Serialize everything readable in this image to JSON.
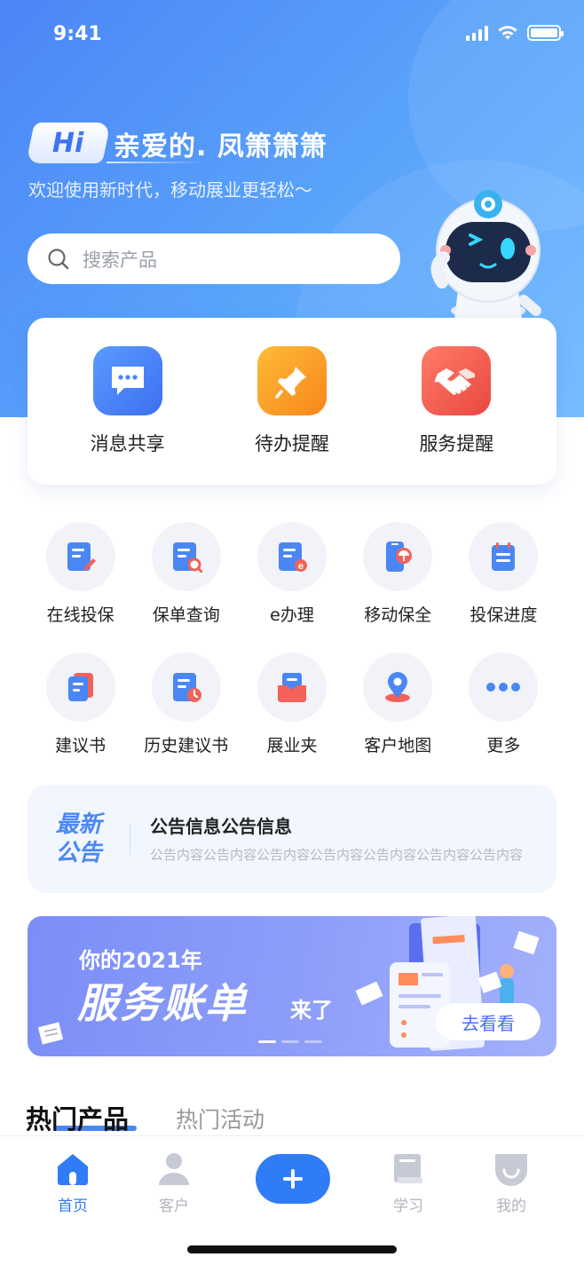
{
  "status": {
    "time": "9:41"
  },
  "greeting": {
    "badge": "Hi",
    "name": "亲爱的. 凤箫箫箫",
    "subtitle": "欢迎使用新时代，移动展业更轻松～"
  },
  "search": {
    "placeholder": "搜索产品"
  },
  "quick_actions": [
    {
      "label": "消息共享",
      "icon": "message-icon",
      "color": "#4a86f4"
    },
    {
      "label": "待办提醒",
      "icon": "pin-icon",
      "color": "#fb9a1e"
    },
    {
      "label": "服务提醒",
      "icon": "handshake-icon",
      "color": "#f2625a"
    }
  ],
  "grid": [
    {
      "label": "在线投保",
      "icon": "online-insure-icon"
    },
    {
      "label": "保单查询",
      "icon": "policy-search-icon"
    },
    {
      "label": "e办理",
      "icon": "e-handle-icon"
    },
    {
      "label": "移动保全",
      "icon": "mobile-preserve-icon"
    },
    {
      "label": "投保进度",
      "icon": "progress-icon"
    },
    {
      "label": "建议书",
      "icon": "proposal-icon"
    },
    {
      "label": "历史建议书",
      "icon": "history-proposal-icon"
    },
    {
      "label": "展业夹",
      "icon": "folder-icon"
    },
    {
      "label": "客户地图",
      "icon": "map-pin-icon"
    },
    {
      "label": "更多",
      "icon": "more-icon"
    }
  ],
  "notice": {
    "badge_line1": "最新",
    "badge_line2": "公告",
    "title": "公告信息公告信息",
    "body": "公告内容公告内容公告内容公告内容公告内容公告内容公告内容"
  },
  "banner": {
    "subtitle": "你的2021年",
    "title": "服务账单",
    "tail": "来了",
    "button": "去看看"
  },
  "tabs": {
    "hot_products": "热门产品",
    "hot_activities": "热门活动"
  },
  "nav": [
    {
      "label": "首页",
      "active": true
    },
    {
      "label": "客户",
      "active": false
    },
    {
      "label": "学习",
      "active": false
    },
    {
      "label": "我的",
      "active": false
    }
  ],
  "colors": {
    "primary": "#2f7cf6",
    "hero_start": "#4b86f5",
    "hero_end": "#6cb8ff"
  }
}
